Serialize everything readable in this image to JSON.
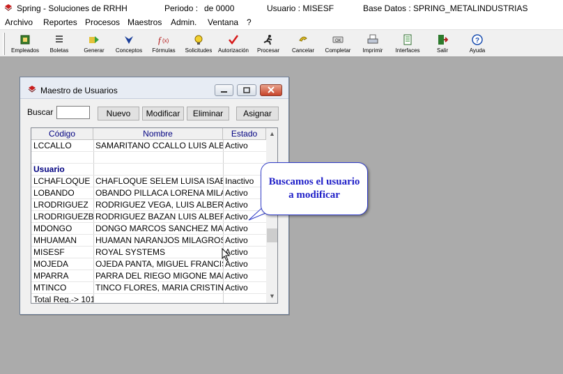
{
  "titlebar": {
    "app": "Spring - Soluciones de RRHH",
    "periodo_label": "Periodo :",
    "periodo_value": "de 0000",
    "usuario": "Usuario : MISESF",
    "base_datos": "Base Datos : SPRING_METALINDUSTRIAS"
  },
  "menu": [
    "Archivo",
    "Reportes",
    "Procesos",
    "Maestros",
    "Admin.",
    "Ventana",
    "?"
  ],
  "toolbar": [
    {
      "label": "Empleados",
      "icon": "employees-icon"
    },
    {
      "label": "Boletas",
      "icon": "payslip-icon"
    },
    {
      "label": "Generar",
      "icon": "generate-icon"
    },
    {
      "label": "Conceptos",
      "icon": "concepts-icon"
    },
    {
      "label": "Fórmulas",
      "icon": "formula-icon"
    },
    {
      "label": "Solicitudes",
      "icon": "requests-icon"
    },
    {
      "label": "Autorización",
      "icon": "checkmark-icon"
    },
    {
      "label": "Procesar",
      "icon": "runner-icon"
    },
    {
      "label": "Cancelar",
      "icon": "cancel-icon"
    },
    {
      "label": "Completar",
      "icon": "ok-icon"
    },
    {
      "label": "Imprimir",
      "icon": "printer-icon"
    },
    {
      "label": "Interfaces",
      "icon": "interfaces-icon"
    },
    {
      "label": "Salir",
      "icon": "exit-door-icon"
    },
    {
      "label": "Ayuda",
      "icon": "help-icon"
    }
  ],
  "dialog": {
    "title": "Maestro de Usuarios",
    "search_label": "Buscar",
    "search_value": "",
    "buttons": {
      "nuevo": "Nuevo",
      "modificar": "Modificar",
      "eliminar": "Eliminar",
      "asignar": "Asignar"
    },
    "columns": [
      "Código",
      "Nombre",
      "Estado"
    ],
    "rows": [
      {
        "codigo": "LCCALLO",
        "nombre": "SAMARITANO CCALLO LUIS ALBERTO",
        "estado": "Activo"
      },
      {
        "codigo": "",
        "nombre": "",
        "estado": ""
      },
      {
        "codigo": "Usuario",
        "nombre": "",
        "estado": "",
        "group": true
      },
      {
        "codigo": "LCHAFLOQUE",
        "nombre": "CHAFLOQUE SELEM LUISA ISABEL",
        "estado": "Inactivo"
      },
      {
        "codigo": "LOBANDO",
        "nombre": "OBANDO PILLACA LORENA MILAGROS",
        "estado": "Activo"
      },
      {
        "codigo": "LRODRIGUEZ",
        "nombre": "RODRIGUEZ VEGA, LUIS  ALBERTO",
        "estado": "Activo"
      },
      {
        "codigo": "LRODRIGUEZBA",
        "nombre": "RODRIGUEZ BAZAN LUIS ALBERTO",
        "estado": "Activo"
      },
      {
        "codigo": "MDONGO",
        "nombre": "DONGO MARCOS SANCHEZ MARIO",
        "estado": "Activo"
      },
      {
        "codigo": "MHUAMAN",
        "nombre": "HUAMAN NARANJOS MILAGROS DEL",
        "estado": "Activo"
      },
      {
        "codigo": "MISESF",
        "nombre": "ROYAL SYSTEMS",
        "estado": "Activo"
      },
      {
        "codigo": "MOJEDA",
        "nombre": "OJEDA PANTA, MIGUEL  FRANCISCO",
        "estado": "Activo"
      },
      {
        "codigo": "MPARRA",
        "nombre": "PARRA DEL RIEGO MIGONE MANUEL",
        "estado": "Activo"
      },
      {
        "codigo": "MTINCO",
        "nombre": "TINCO FLORES, MARIA  CRISTINA",
        "estado": "Activo"
      },
      {
        "codigo": "Total Reg.-> 101",
        "nombre": "",
        "estado": ""
      }
    ]
  },
  "callout": {
    "line1": "Buscamos el usuario",
    "line2": "a modificar"
  },
  "colors": {
    "workspace": "#ababab",
    "header_text": "#000080",
    "callout_border": "#2e3ac7",
    "callout_text": "#2020c8"
  }
}
